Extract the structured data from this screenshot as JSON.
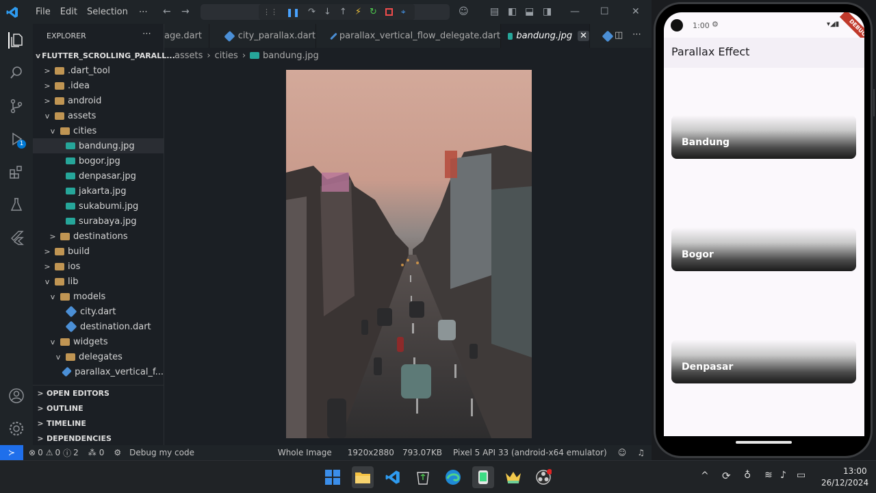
{
  "titlebar": {
    "menu": [
      "File",
      "Edit",
      "Selection",
      "⋯"
    ]
  },
  "sidebar": {
    "header": "EXPLORER",
    "project": "FLUTTER_SCROLLING_PARALL...",
    "tree": [
      {
        "label": ".dart_tool",
        "depth": 1,
        "kind": "folder",
        "chevron": ">"
      },
      {
        "label": ".idea",
        "depth": 1,
        "kind": "folder",
        "chevron": ">"
      },
      {
        "label": "android",
        "depth": 1,
        "kind": "folder",
        "chevron": ">"
      },
      {
        "label": "assets",
        "depth": 1,
        "kind": "folder",
        "chevron": "v"
      },
      {
        "label": "cities",
        "depth": 2,
        "kind": "folder",
        "chevron": "v"
      },
      {
        "label": "bandung.jpg",
        "depth": 3,
        "kind": "image",
        "selected": true
      },
      {
        "label": "bogor.jpg",
        "depth": 3,
        "kind": "image"
      },
      {
        "label": "denpasar.jpg",
        "depth": 3,
        "kind": "image"
      },
      {
        "label": "jakarta.jpg",
        "depth": 3,
        "kind": "image"
      },
      {
        "label": "sukabumi.jpg",
        "depth": 3,
        "kind": "image"
      },
      {
        "label": "surabaya.jpg",
        "depth": 3,
        "kind": "image"
      },
      {
        "label": "destinations",
        "depth": 2,
        "kind": "folder",
        "chevron": ">"
      },
      {
        "label": "build",
        "depth": 1,
        "kind": "folder",
        "chevron": ">"
      },
      {
        "label": "ios",
        "depth": 1,
        "kind": "folder",
        "chevron": ">"
      },
      {
        "label": "lib",
        "depth": 1,
        "kind": "folder",
        "chevron": "v"
      },
      {
        "label": "models",
        "depth": 2,
        "kind": "folder",
        "chevron": "v"
      },
      {
        "label": "city.dart",
        "depth": 3,
        "kind": "dart"
      },
      {
        "label": "destination.dart",
        "depth": 3,
        "kind": "dart"
      },
      {
        "label": "widgets",
        "depth": 2,
        "kind": "folder",
        "chevron": "v"
      },
      {
        "label": "delegates",
        "depth": 3,
        "kind": "folder",
        "chevron": "v"
      },
      {
        "label": "parallax_vertical_f...",
        "depth": 4,
        "kind": "dart"
      }
    ],
    "sections": [
      "OPEN EDITORS",
      "OUTLINE",
      "TIMELINE",
      "DEPENDENCIES"
    ]
  },
  "tabs": [
    {
      "label": "age.dart",
      "active": false
    },
    {
      "label": "city_parallax.dart",
      "active": false
    },
    {
      "label": "parallax_vertical_flow_delegate.dart",
      "active": false
    },
    {
      "label": "bandung.jpg",
      "active": true
    }
  ],
  "breadcrumb": [
    "assets",
    "cities",
    "bandung.jpg"
  ],
  "activity_badge": "1",
  "statusbar": {
    "errors": "0",
    "warnings": "0",
    "info": "2",
    "ports": "0",
    "debug": "Debug my code",
    "view": "Whole Image",
    "dimensions": "1920x2880",
    "filesize": "793.07KB",
    "device": "Pixel 5 API 33 (android-x64 emulator)"
  },
  "phone": {
    "time": "1:00",
    "appbar_title": "Parallax Effect",
    "debug_banner": "DEBUG",
    "cards": [
      "Bandung",
      "Bogor",
      "Denpasar"
    ]
  },
  "taskbar": {
    "time": "13:00",
    "date": "26/12/2024"
  },
  "colors": {
    "accent": "#0078d4",
    "statusbar_remote": "#1f6feb",
    "folder": "#c09553",
    "image_icon": "#26a69a",
    "dart_icon": "#4b8fd6"
  }
}
